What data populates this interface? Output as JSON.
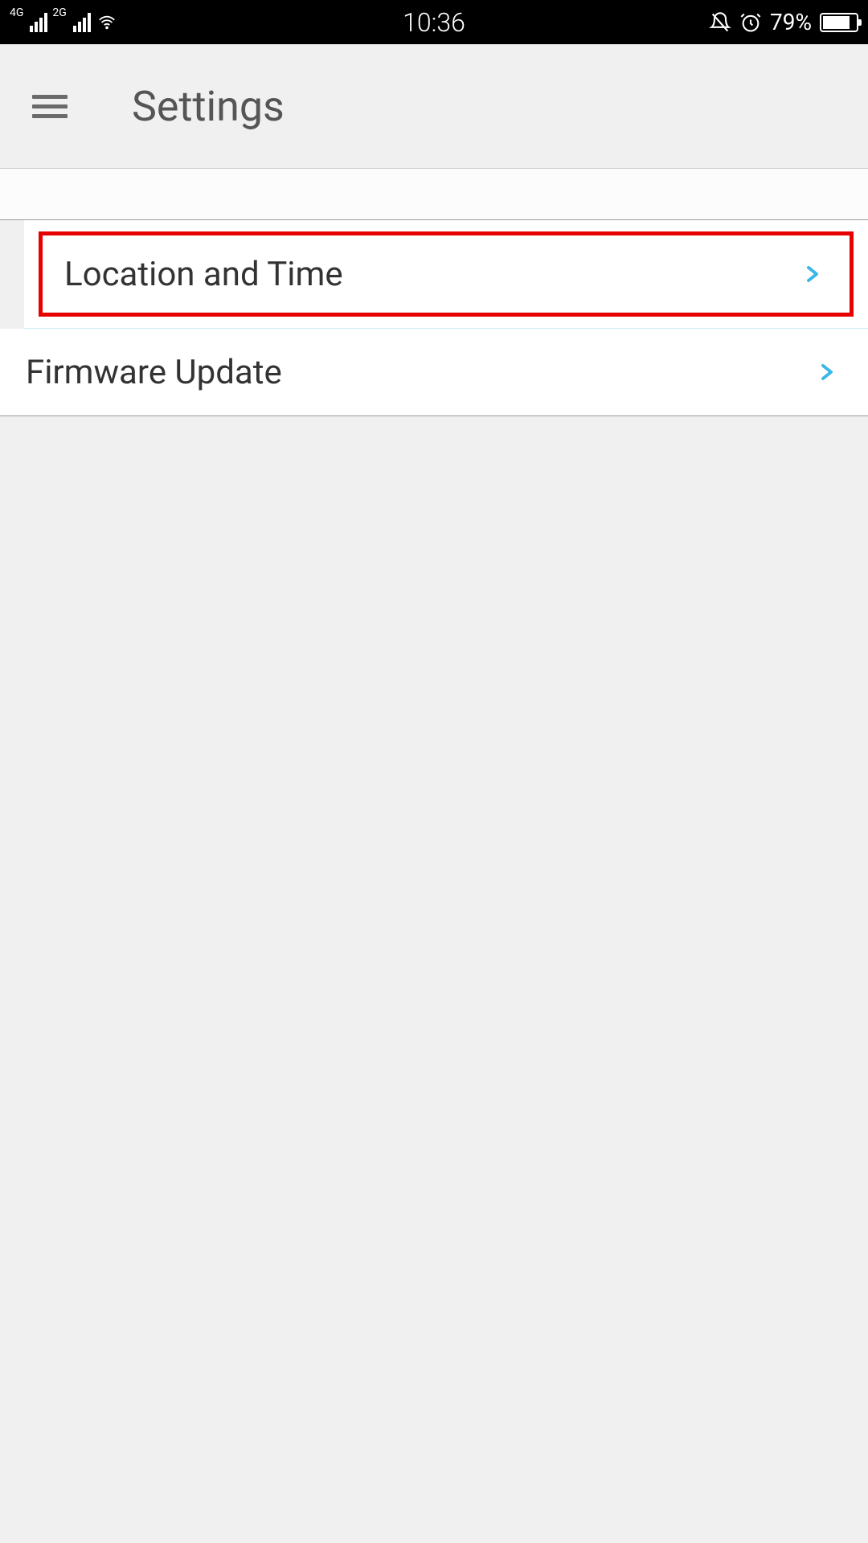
{
  "statusBar": {
    "signal1Label": "4G",
    "signal2Label": "2G",
    "time": "10:36",
    "batteryPercent": "79%"
  },
  "header": {
    "title": "Settings"
  },
  "list": {
    "items": [
      {
        "label": "Location and Time"
      },
      {
        "label": "Firmware Update"
      }
    ]
  }
}
